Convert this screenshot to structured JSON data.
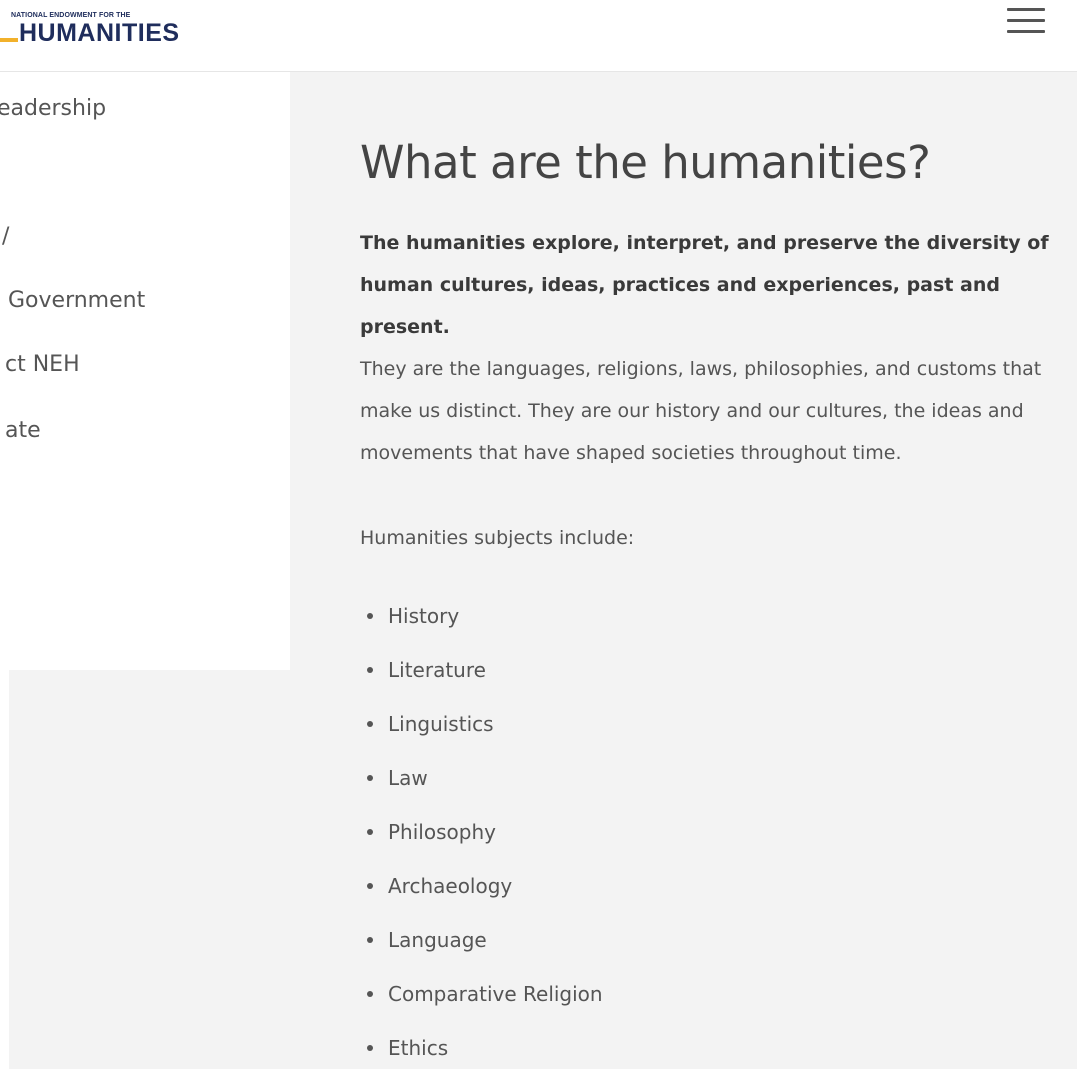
{
  "header": {
    "logo_top_text": "NATIONAL ENDOWMENT FOR THE",
    "logo_main_text": "HUMANITIES",
    "menu_icon": "hamburger-menu-icon"
  },
  "side_menu": {
    "items": [
      {
        "label": "eadership"
      },
      {
        "label": "/"
      },
      {
        "label": "Government"
      },
      {
        "label": "ct NEH"
      },
      {
        "label": "ate"
      }
    ]
  },
  "main": {
    "title": "What are the humanities?",
    "lead": "The humanities explore, interpret, and preserve the diversity of human cultures, ideas, practices and experiences, past and present.",
    "paragraph": "They are the languages, religions, laws, philosophies, and customs that make us distinct. They are our history and our cultures, the ideas and movements that have shaped societies throughout time.",
    "subjects_intro": "Humanities subjects include:",
    "subjects": [
      "History",
      "Literature",
      "Linguistics",
      "Law",
      "Philosophy",
      "Archaeology",
      "Language",
      "Comparative Religion",
      "Ethics"
    ]
  },
  "colors": {
    "logo_navy": "#1f2d5c",
    "logo_gold": "#f2b12b",
    "content_bg": "#f3f3f3",
    "text": "#555555"
  }
}
